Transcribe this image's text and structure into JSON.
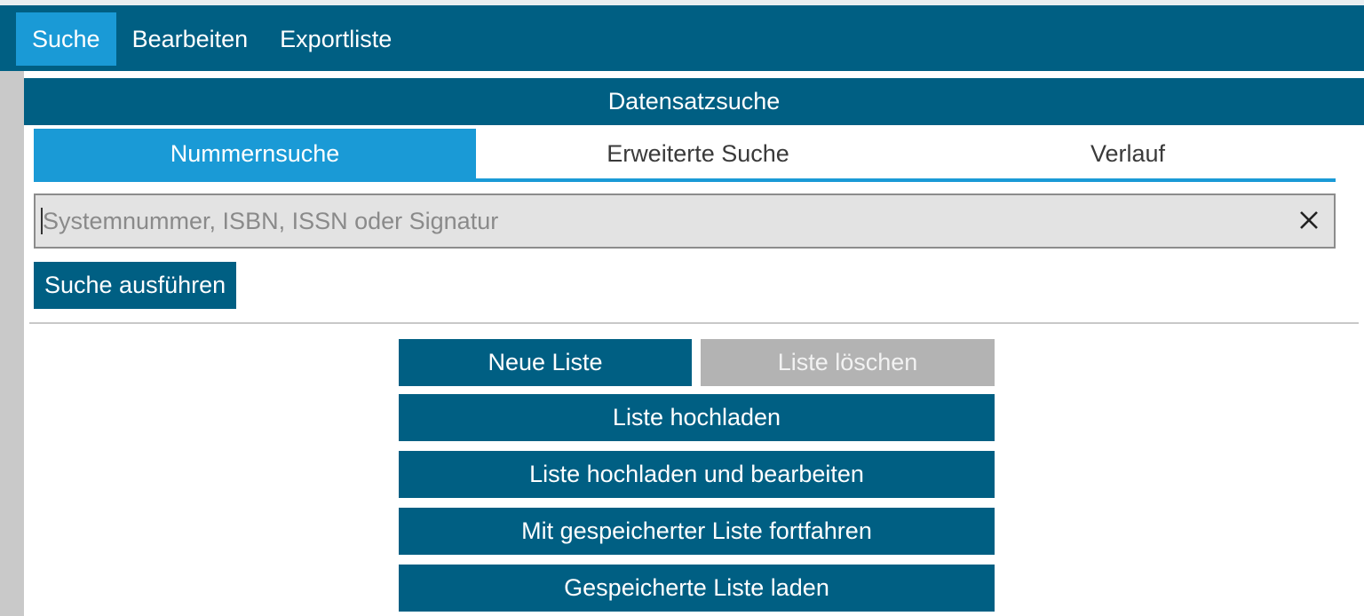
{
  "menu": {
    "items": [
      {
        "label": "Suche",
        "active": true
      },
      {
        "label": "Bearbeiten",
        "active": false
      },
      {
        "label": "Exportliste",
        "active": false
      }
    ]
  },
  "panel": {
    "title": "Datensatzsuche",
    "tabs": [
      {
        "label": "Nummernsuche",
        "active": true
      },
      {
        "label": "Erweiterte Suche",
        "active": false
      },
      {
        "label": "Verlauf",
        "active": false
      }
    ],
    "search": {
      "value": "",
      "placeholder": "Systemnummer, ISBN, ISSN oder Signatur",
      "clear_icon": "close-icon"
    },
    "execute_label": "Suche ausführen"
  },
  "list_actions": {
    "new_list": "Neue Liste",
    "delete_list": "Liste löschen",
    "upload_list": "Liste hochladen",
    "upload_and_edit": "Liste hochladen und bearbeiten",
    "continue_saved": "Mit gespeicherter Liste fortfahren",
    "load_saved": "Gespeicherte Liste laden"
  },
  "colors": {
    "primary": "#005f83",
    "accent": "#1a9ad6",
    "disabled": "#b3b3b3"
  }
}
